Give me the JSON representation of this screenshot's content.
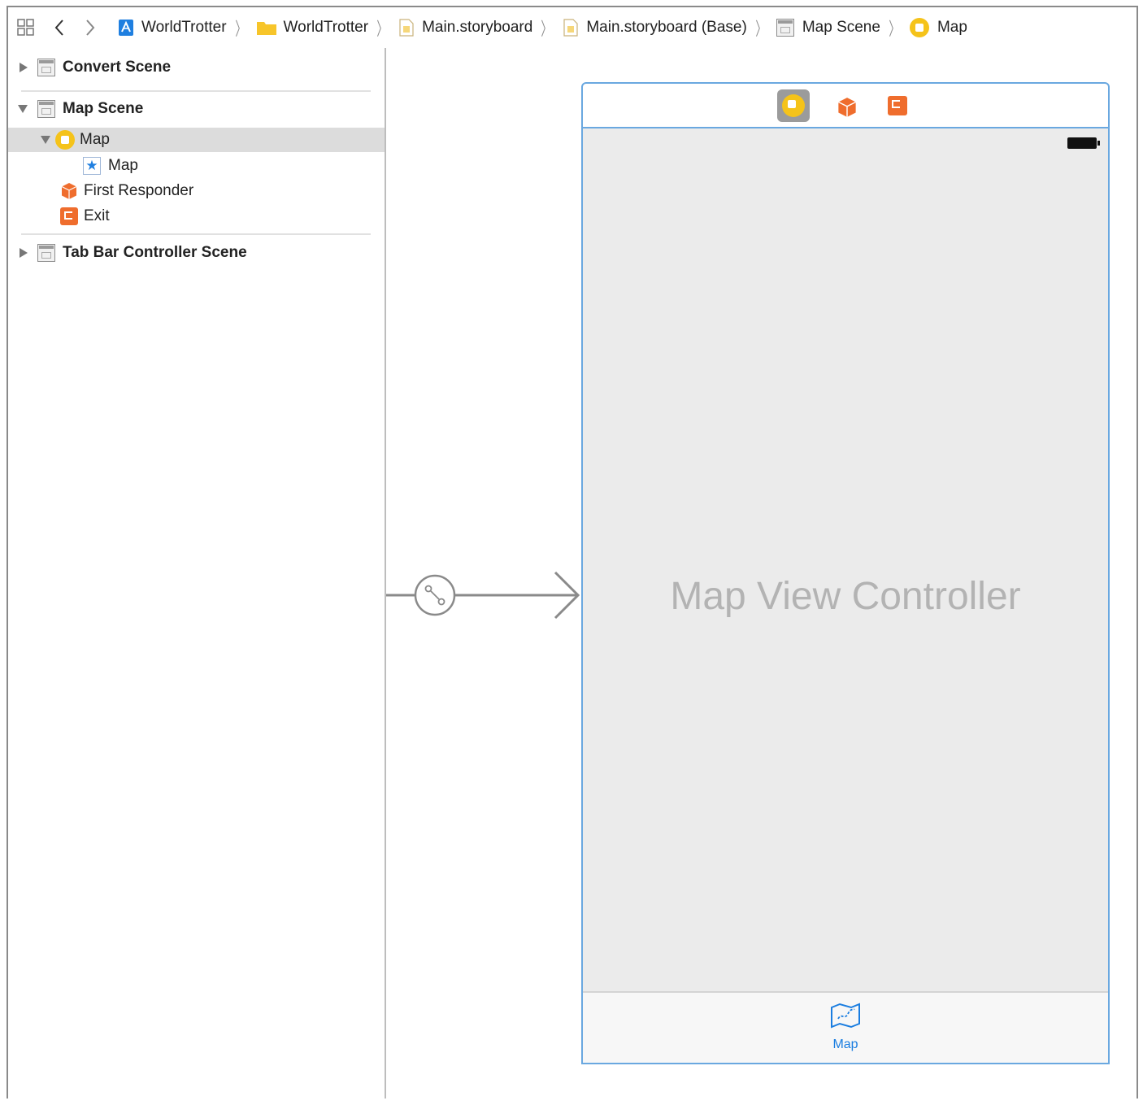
{
  "breadcrumbs": [
    {
      "label": "WorldTrotter",
      "icon": "project-icon"
    },
    {
      "label": "WorldTrotter",
      "icon": "folder-icon"
    },
    {
      "label": "Main.storyboard",
      "icon": "storyboard-file-icon"
    },
    {
      "label": "Main.storyboard (Base)",
      "icon": "storyboard-file-icon"
    },
    {
      "label": "Map Scene",
      "icon": "scene-icon"
    },
    {
      "label": "Map",
      "icon": "view-controller-icon"
    }
  ],
  "outline": {
    "convert_scene": "Convert Scene",
    "map_scene": "Map Scene",
    "map_vc": "Map",
    "map_tab_item": "Map",
    "first_responder": "First Responder",
    "exit": "Exit",
    "tab_bar_scene": "Tab Bar Controller Scene"
  },
  "canvas": {
    "view_controller_title": "Map View Controller",
    "tab_item_label": "Map"
  },
  "colors": {
    "accent": "#1a7de0",
    "selection_frame": "#6aa8e0",
    "vc_yellow": "#f5c31a",
    "exit_orange": "#ef6d2d"
  }
}
